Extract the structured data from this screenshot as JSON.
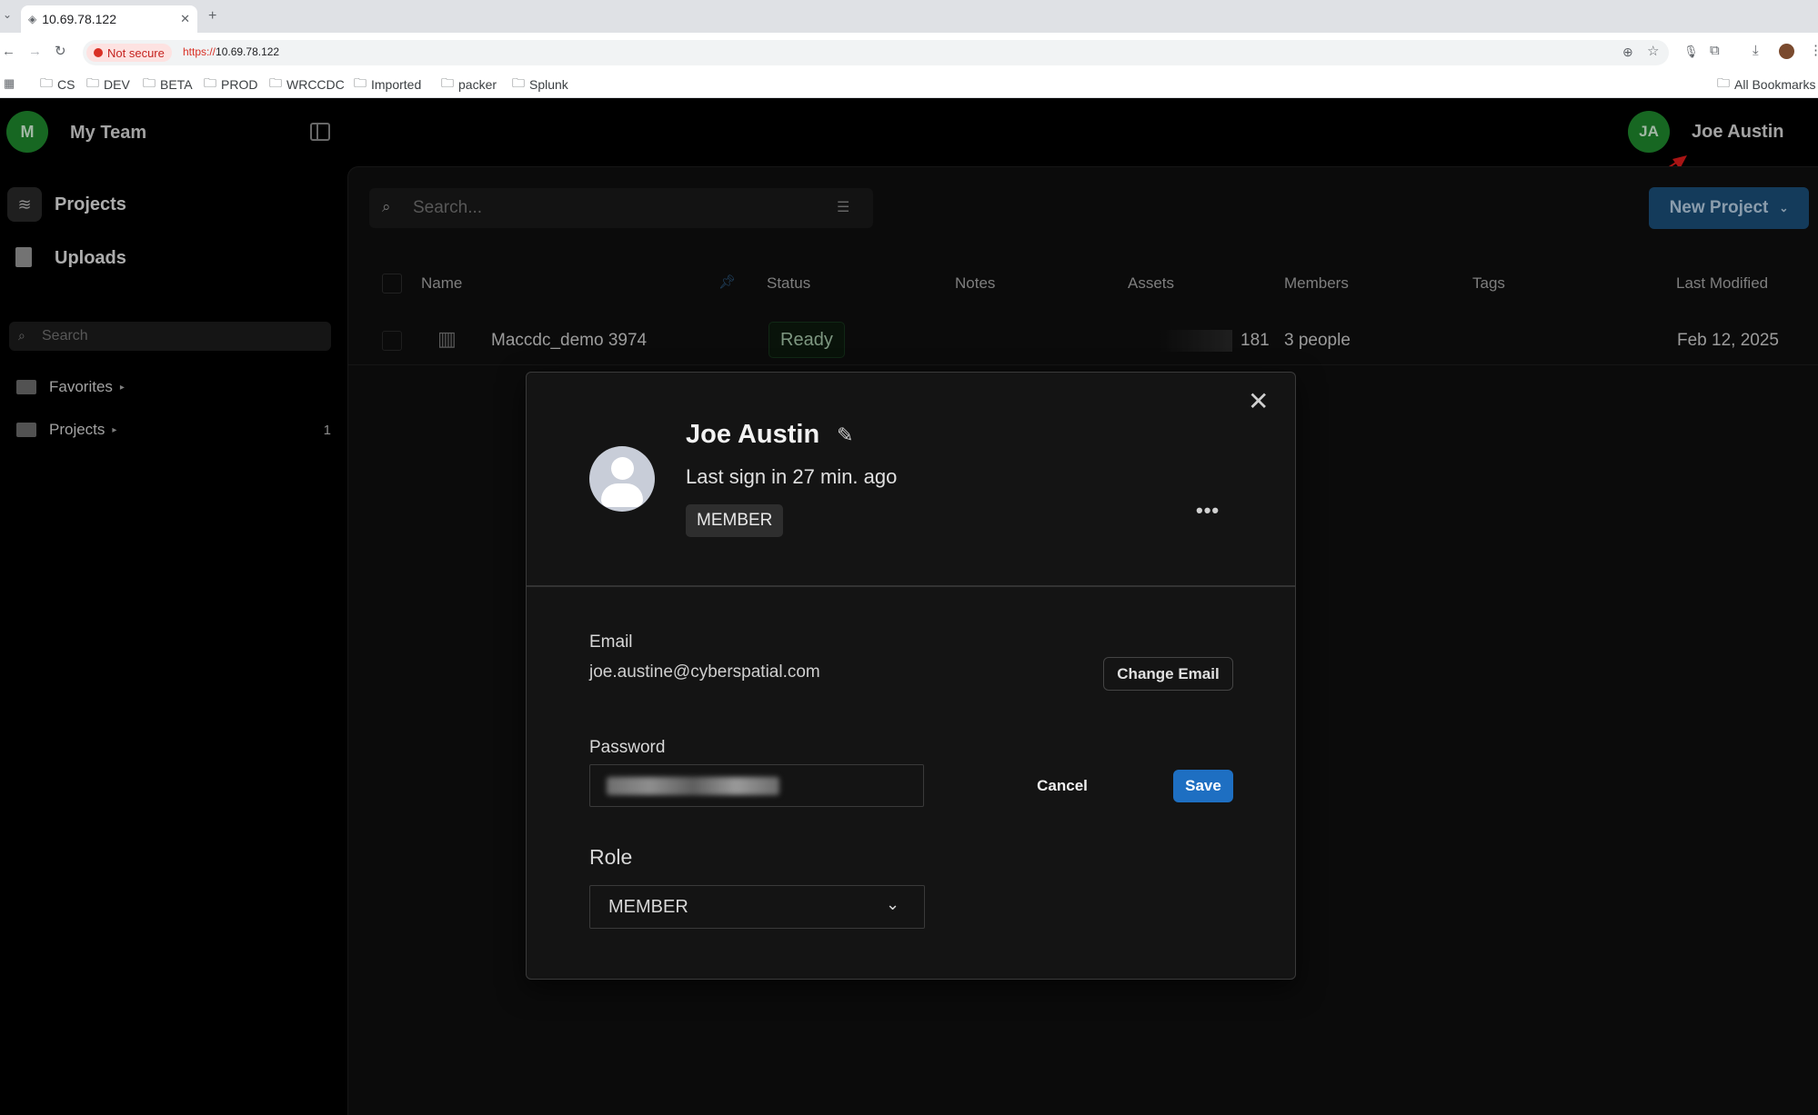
{
  "browser": {
    "tab_title": "10.69.78.122",
    "not_secure": "Not secure",
    "url_scheme": "https://",
    "url_host": "10.69.78.122",
    "bookmarks": [
      "CS",
      "DEV",
      "BETA",
      "PROD",
      "WRCCDC",
      "Imported",
      "packer",
      "Splunk"
    ],
    "all_bookmarks": "All Bookmarks"
  },
  "team": {
    "initial": "M",
    "name": "My Team",
    "color": "#1f8a2e"
  },
  "nav": {
    "projects": "Projects",
    "uploads": "Uploads"
  },
  "sidebar_search": {
    "placeholder": "Search"
  },
  "tree": {
    "favorites": "Favorites",
    "projects": "Projects",
    "projects_count": "1"
  },
  "user": {
    "initials": "JA",
    "name": "Joe Austin"
  },
  "main_search": {
    "placeholder": "Search..."
  },
  "new_project": {
    "label": "New Project",
    "color": "#1b4f7a"
  },
  "table": {
    "headers": {
      "name": "Name",
      "status": "Status",
      "notes": "Notes",
      "assets": "Assets",
      "members": "Members",
      "tags": "Tags",
      "last_modified": "Last Modified"
    },
    "rows": [
      {
        "name": "Maccdc_demo 3974",
        "status": "Ready",
        "assets": "181",
        "members": "3 people",
        "last_modified": "Feb 12, 2025"
      }
    ]
  },
  "modal": {
    "name": "Joe Austin",
    "last_sign_in": "Last sign in 27 min. ago",
    "role_badge": "MEMBER",
    "email_label": "Email",
    "email_value": "joe.austine@cyberspatial.com",
    "change_email": "Change Email",
    "password_label": "Password",
    "cancel": "Cancel",
    "save": "Save",
    "role_label": "Role",
    "role_value": "MEMBER",
    "save_color": "#1e6fc2"
  }
}
